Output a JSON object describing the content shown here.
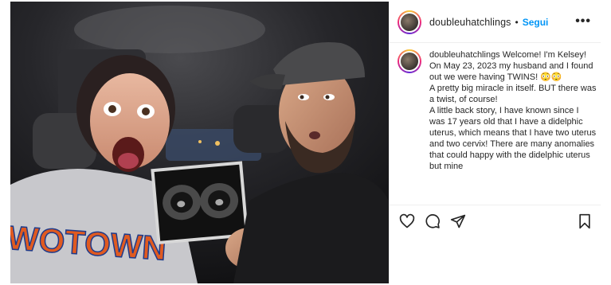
{
  "post": {
    "username": "doubleuhatchlings",
    "separator": "•",
    "follow_label": "Segui",
    "more_label": "•••"
  },
  "caption": {
    "username": "doubleuhatchlings",
    "lines": [
      "Welcome! I'm Kelsey!",
      "On May 23, 2023 my husband and I found out we were having TWINS! 😳😳",
      "A pretty big miracle in itself. BUT there was a twist, of course!",
      "A little back story, I have known since I was 17 years old that I have a didelphic uterus, which means that I have two uterus and two cervix! There are many anomalies that could happy with the didelphic uterus but mine"
    ]
  },
  "photo": {
    "shirt_text": "WOTOWN"
  },
  "icons": {
    "like": "heart-icon",
    "comment": "comment-icon",
    "share": "send-icon",
    "save": "bookmark-icon"
  },
  "colors": {
    "follow_blue": "#0095f6",
    "text": "#262626",
    "divider": "#efefef"
  }
}
